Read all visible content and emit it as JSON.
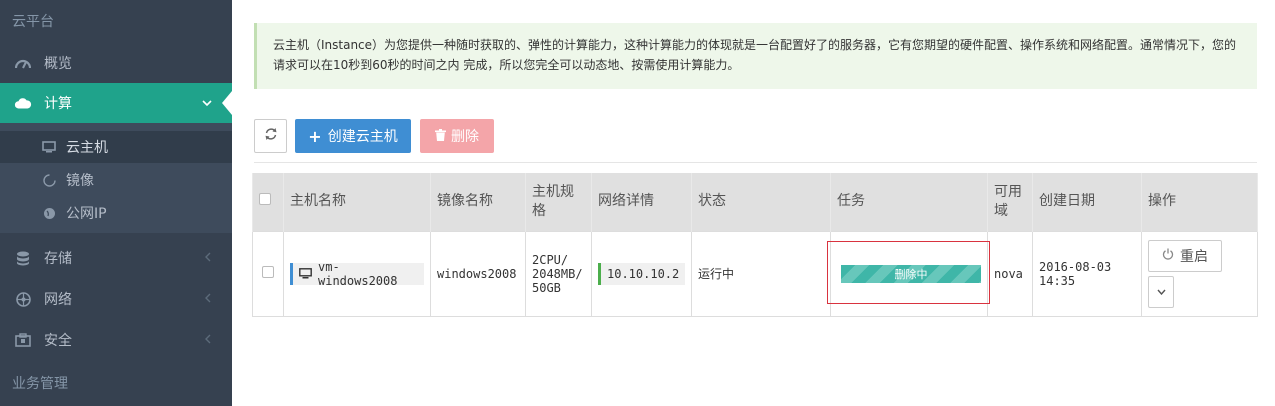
{
  "sidebar": {
    "title": "云平台",
    "items": [
      {
        "label": "概览",
        "icon": "dashboard-icon"
      },
      {
        "label": "计算",
        "icon": "cloud-icon"
      },
      {
        "label": "存储",
        "icon": "database-icon"
      },
      {
        "label": "网络",
        "icon": "network-icon"
      },
      {
        "label": "安全",
        "icon": "security-icon"
      }
    ],
    "sub_items": [
      {
        "label": "云主机",
        "icon": "monitor-icon"
      },
      {
        "label": "镜像",
        "icon": "spinner-icon"
      },
      {
        "label": "公网IP",
        "icon": "globe-icon"
      }
    ],
    "section": "业务管理"
  },
  "alert": {
    "text": "云主机（Instance）为您提供一种随时获取的、弹性的计算能力，这种计算能力的体现就是一台配置好了的服务器，它有您期望的硬件配置、操作系统和网络配置。通常情况下，您的请求可以在10秒到60秒的时间之内 完成，所以您完全可以动态地、按需使用计算能力。"
  },
  "toolbar": {
    "create_label": "创建云主机",
    "delete_label": "删除"
  },
  "table": {
    "headers": [
      "主机名称",
      "镜像名称",
      "主机规格",
      "网络详情",
      "状态",
      "任务",
      "可用域",
      "创建日期",
      "操作"
    ],
    "rows": [
      {
        "name": "vm-windows2008",
        "image": "windows2008",
        "spec_line1": "2CPU/",
        "spec_line2": "2048MB/",
        "spec_line3": "50GB",
        "network": "10.10.10.2",
        "status": "运行中",
        "task": "删除中",
        "task_progress_percent": 100,
        "zone": "nova",
        "date_line1": "2016-08-03",
        "date_line2": "14:35",
        "action_label": "重启"
      }
    ]
  },
  "colors": {
    "sidebar_bg": "#364150",
    "sidebar_active": "#1fa38b",
    "primary": "#3f8ed3",
    "danger_light": "#f4a5a9",
    "progress": "#3fb6a8",
    "highlight_border": "#d9333f"
  }
}
